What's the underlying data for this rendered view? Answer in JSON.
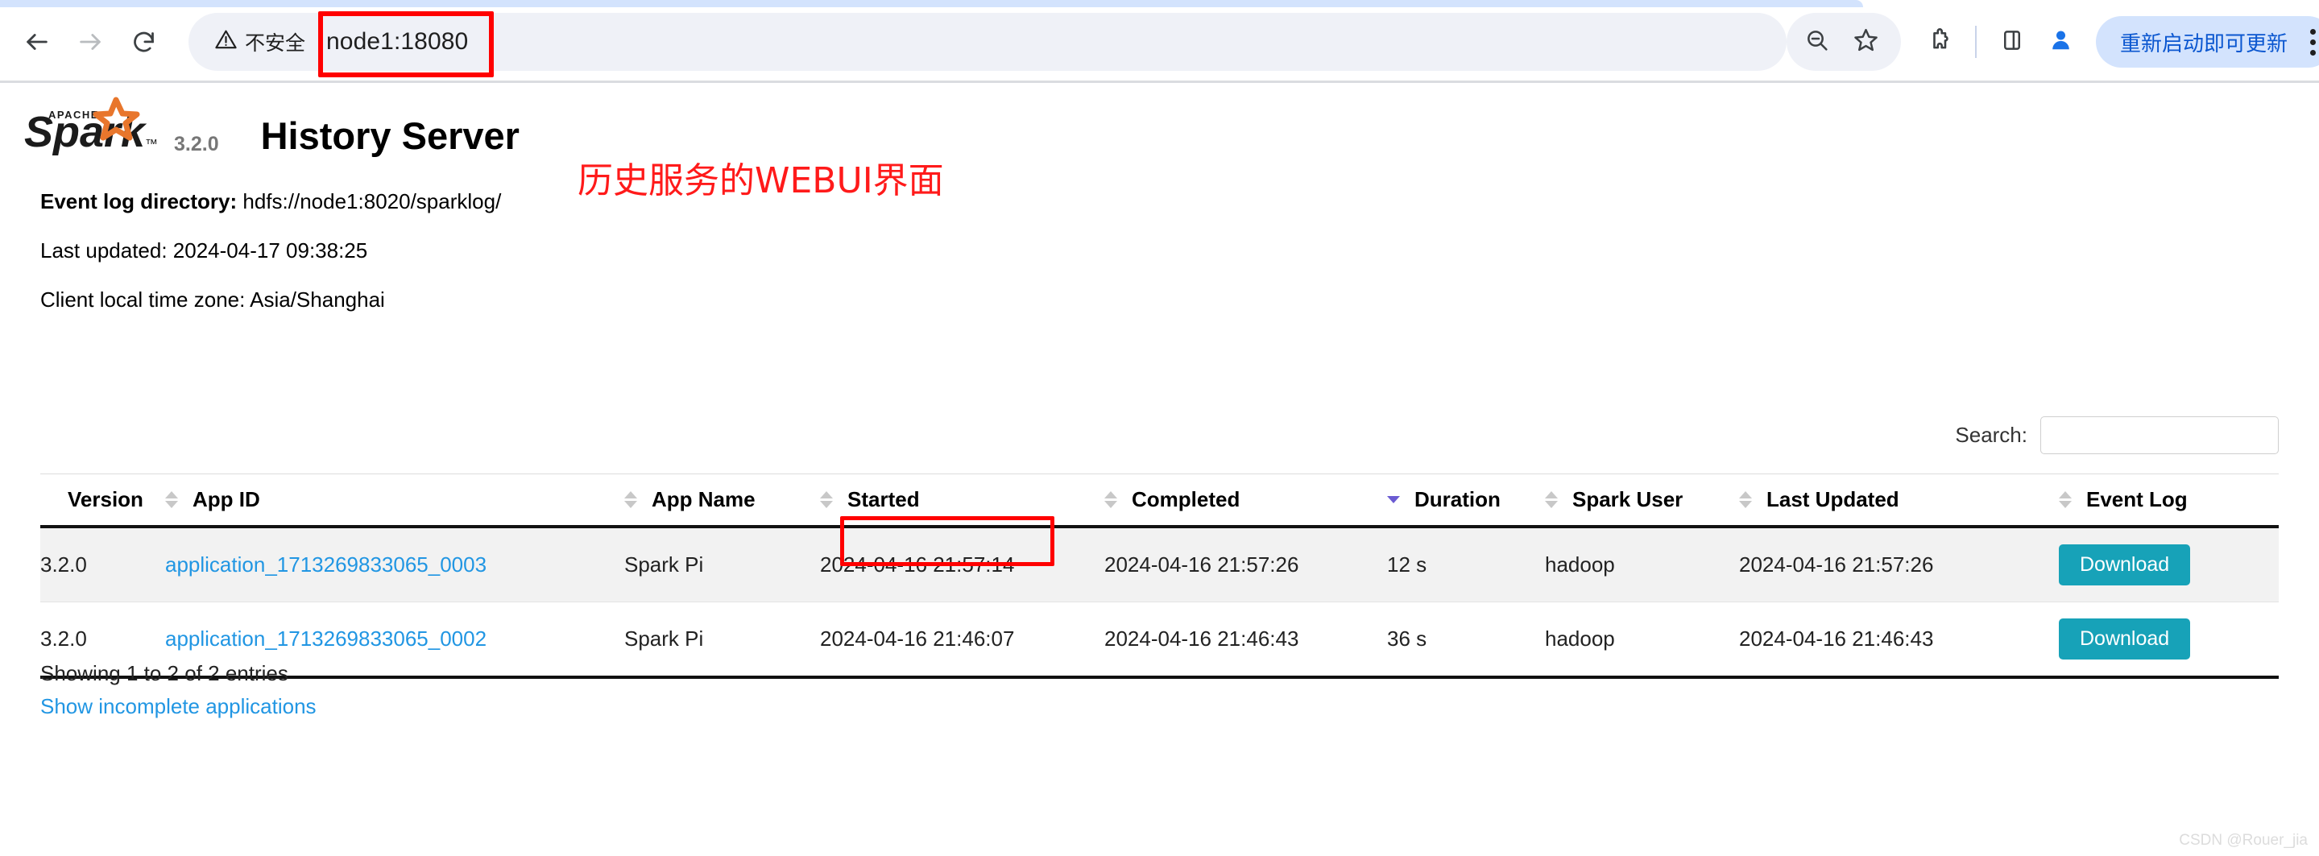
{
  "browser": {
    "back_icon": "arrow-left-icon",
    "forward_icon": "arrow-right-icon",
    "reload_icon": "reload-icon",
    "security_label": "不安全",
    "security_icon": "warning-triangle-icon",
    "url": "node1:18080",
    "zoom_out_icon": "zoom-out-icon",
    "bookmark_icon": "star-icon",
    "extensions_icon": "puzzle-piece-icon",
    "side_panel_icon": "side-panel-icon",
    "profile_icon": "profile-avatar-icon",
    "update_button_label": "重新启动即可更新",
    "menu_icon": "three-dot-menu-icon"
  },
  "page": {
    "logo_alt": "apache-spark-logo",
    "version": "3.2.0",
    "title": "History Server",
    "annotation": "历史服务的WEBUI界面",
    "event_log_label": "Event log directory:",
    "event_log_value": "hdfs://node1:8020/sparklog/",
    "last_updated": "Last updated: 2024-04-17 09:38:25",
    "time_zone": "Client local time zone: Asia/Shanghai",
    "watermark": "CSDN @Rouer_jia"
  },
  "search": {
    "label": "Search:",
    "value": "",
    "placeholder": ""
  },
  "table": {
    "columns": [
      {
        "label": "Version",
        "sort": "none"
      },
      {
        "label": "App ID",
        "sort": "both"
      },
      {
        "label": "App Name",
        "sort": "both"
      },
      {
        "label": "Started",
        "sort": "both"
      },
      {
        "label": "Completed",
        "sort": "both"
      },
      {
        "label": "Duration",
        "sort": "desc"
      },
      {
        "label": "Spark User",
        "sort": "both"
      },
      {
        "label": "Last Updated",
        "sort": "both"
      },
      {
        "label": "Event Log",
        "sort": "both"
      }
    ],
    "rows": [
      {
        "version": "3.2.0",
        "app_id": "application_1713269833065_0003",
        "app_name": "Spark Pi",
        "started": "2024-04-16 21:57:14",
        "completed": "2024-04-16 21:57:26",
        "duration": "12 s",
        "spark_user": "hadoop",
        "last_updated": "2024-04-16 21:57:26",
        "event_log": "Download"
      },
      {
        "version": "3.2.0",
        "app_id": "application_1713269833065_0002",
        "app_name": "Spark Pi",
        "started": "2024-04-16 21:46:07",
        "completed": "2024-04-16 21:46:43",
        "duration": "36 s",
        "spark_user": "hadoop",
        "last_updated": "2024-04-16 21:46:43",
        "event_log": "Download"
      }
    ]
  },
  "footer": {
    "showing_entries": "Showing 1 to 2 of 2 entries",
    "show_incomplete": "Show incomplete applications"
  },
  "colors": {
    "accent_blue": "#2196e3",
    "download_teal": "#17a2b8",
    "annotation_red": "#ff0000",
    "chrome_blue": "#0b57d0"
  }
}
